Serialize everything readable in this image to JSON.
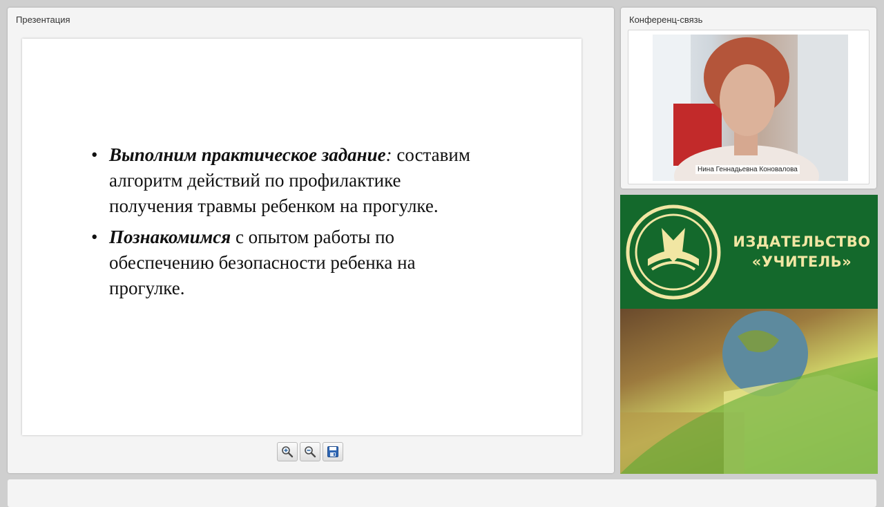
{
  "presentation": {
    "title": "Презентация",
    "slide": {
      "bullets": [
        {
          "bold": "Выполним практическое задание",
          "punct": ":",
          "text": " составим алгоритм действий по профилактике получения травмы ребенком на прогулке."
        },
        {
          "bold": "Познакомимся",
          "punct": "",
          "text": " с опытом работы по обеспечению безопасности ребенка на прогулке."
        }
      ]
    },
    "toolbar": {
      "zoom_in": "zoom-in-icon",
      "zoom_out": "zoom-out-icon",
      "save": "save-icon"
    }
  },
  "conference": {
    "title": "Конференц-связь",
    "participant_name": "Нина Геннадьевна Коновалова"
  },
  "banner": {
    "line1": "ИЗДАТЕЛЬСТВО",
    "line2": "«УЧИТЕЛЬ»",
    "colors": {
      "green": "#14692c",
      "gold": "#f1e6a3"
    }
  }
}
